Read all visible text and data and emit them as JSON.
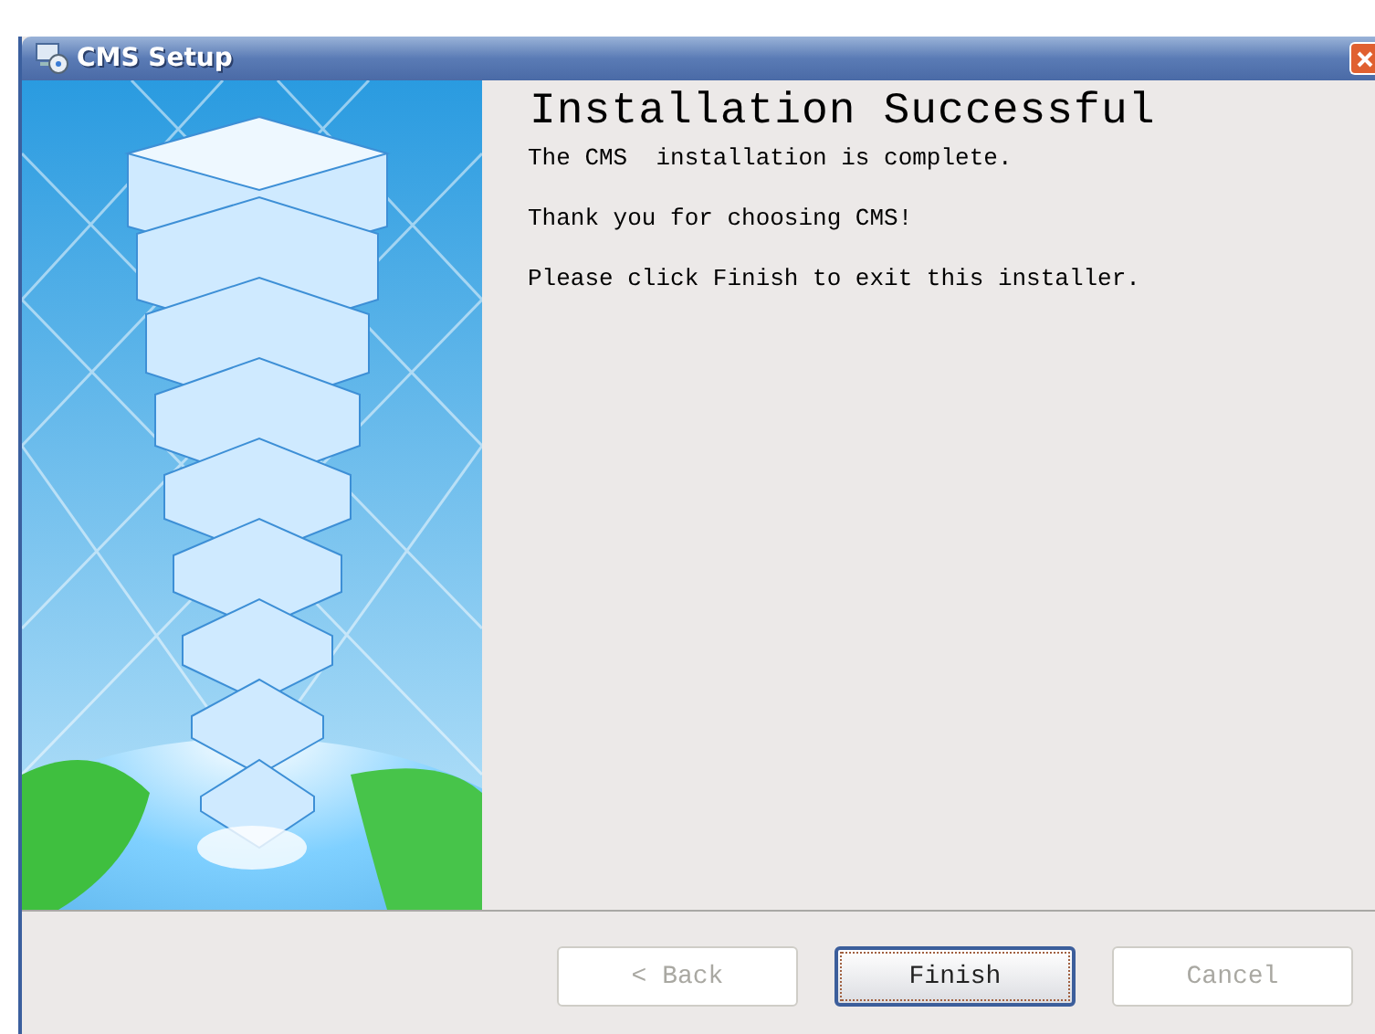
{
  "window": {
    "title": "CMS Setup"
  },
  "heading": "Installation Successful",
  "messages": [
    "The CMS  installation is complete.",
    "Thank you for choosing CMS!",
    "Please click Finish to exit this installer."
  ],
  "buttons": [
    {
      "label": "< Back",
      "disabled": true,
      "default": false
    },
    {
      "label": "Finish",
      "disabled": false,
      "default": true
    },
    {
      "label": "Cancel",
      "disabled": true,
      "default": false
    }
  ]
}
